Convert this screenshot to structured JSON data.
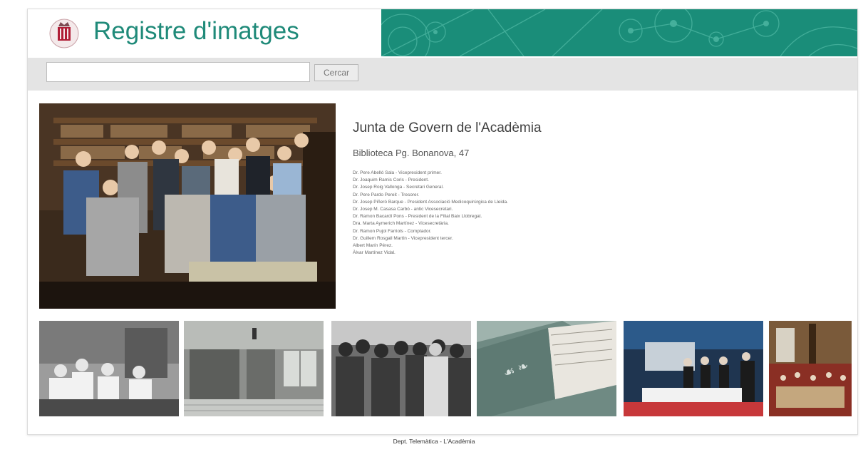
{
  "header": {
    "title": "Registre d'imatges",
    "logo_icon": "academy-crest-icon",
    "accent_color": "#1a8d79",
    "title_color": "#1f8a79"
  },
  "search": {
    "value": "",
    "placeholder": "",
    "button_label": "Cercar"
  },
  "detail": {
    "title": "Junta de Govern de l'Acadèmia",
    "location": "Biblioteca Pg. Bonanova, 47",
    "names": [
      "Dr. Pere Abelló Sala - Vicepresident primer.",
      "Dr. Joaquim Ramis Coris - President.",
      "Dr. Josep Roig Vallonga - Secretari General.",
      "Dr. Pere Pardo Pereit - Tresorer.",
      "Dr. Josep Piñeró Barque - President Associació Medicoquirúrgica de Lleida.",
      "Dr. Josep M. Casasa Carbó - antic Vicesecretari.",
      "Dr. Ramon Bacardí Pons - President de la Filial Baix Llobregat.",
      "Dra. Marta Aymerich Martínez - Vicesecretària.",
      "Dr. Ramon Pujol Farriols - Comptador.",
      "Dr. Guillem Rosgall Martín - Vicepresident tercer.",
      "Albert Marín Pérez.",
      "Àlvar Martínez Vidal."
    ]
  },
  "thumbnails": [
    {
      "subject": "historic-lab-photo"
    },
    {
      "subject": "library-room-photo"
    },
    {
      "subject": "crowd-photo"
    },
    {
      "subject": "open-book-photo"
    },
    {
      "subject": "ceremony-photo"
    },
    {
      "subject": "assembly-hall-photo"
    }
  ],
  "footer": {
    "text": "Dept. Telemàtica - L'Acadèmia"
  }
}
